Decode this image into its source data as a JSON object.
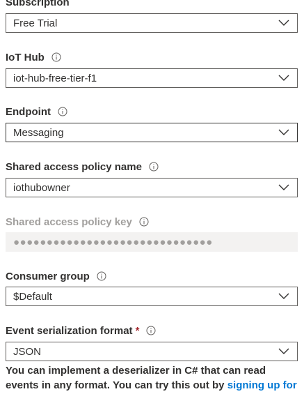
{
  "subscription": {
    "label": "Subscription",
    "value": "Free Trial"
  },
  "iot_hub": {
    "label": "IoT Hub",
    "value": "iot-hub-free-tier-f1"
  },
  "endpoint": {
    "label": "Endpoint",
    "value": "Messaging"
  },
  "shared_access_policy_name": {
    "label": "Shared access policy name",
    "value": "iothubowner"
  },
  "shared_access_policy_key": {
    "label": "Shared access policy key",
    "value": "●●●●●●●●●●●●●●●●●●●●●●●●●●●●●●"
  },
  "consumer_group": {
    "label": "Consumer group",
    "value": "$Default"
  },
  "event_serialization_format": {
    "label": "Event serialization format",
    "required_marker": "*",
    "value": "JSON",
    "description": "You can implement a deserializer in C# that can read events in any format. You can try this out by ",
    "link_text": "signing up for"
  },
  "icons": {
    "info": "info-icon",
    "dropdown": "chevron-down-icon"
  },
  "colors": {
    "text": "#323130",
    "disabled_text": "#a19f9d",
    "border": "#605e5c",
    "disabled_bg": "#f3f2f1",
    "required": "#a4262c",
    "link": "#0078d4"
  }
}
